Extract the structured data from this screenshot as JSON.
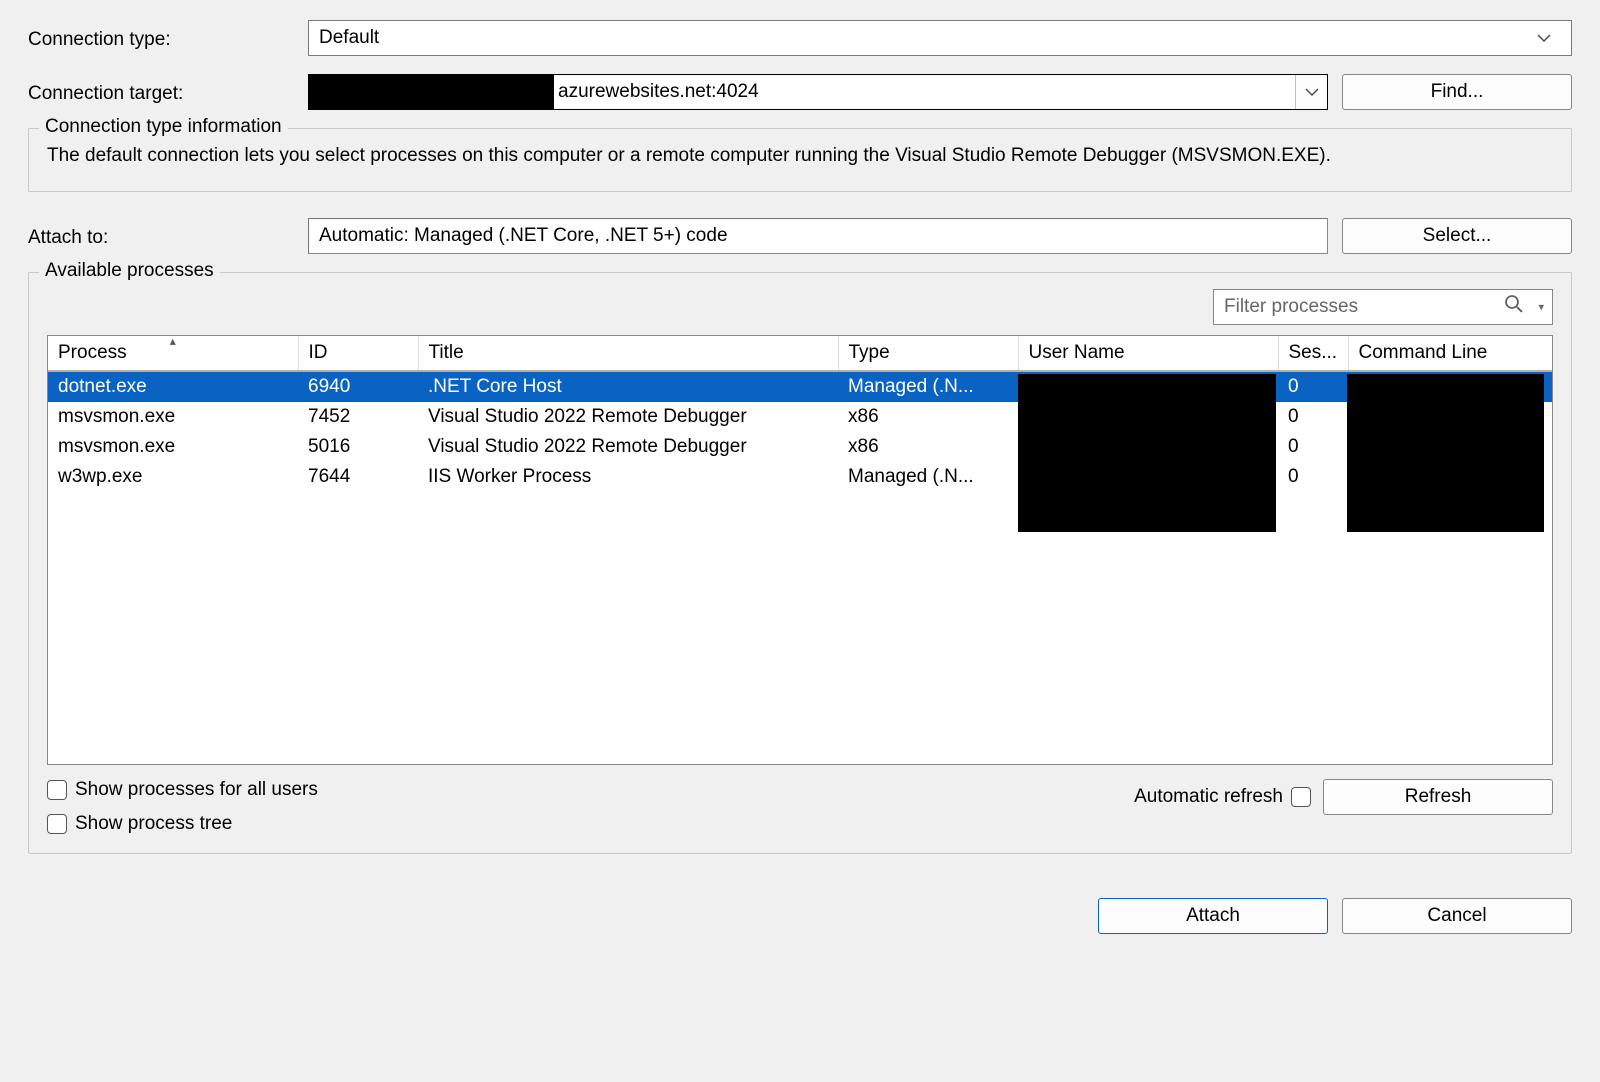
{
  "labels": {
    "connection_type": "Connection type:",
    "connection_target": "Connection target:",
    "attach_to": "Attach to:",
    "find_btn": "Find...",
    "select_btn": "Select...",
    "refresh_btn": "Refresh",
    "attach_btn": "Attach",
    "cancel_btn": "Cancel",
    "automatic_refresh": "Automatic refresh",
    "show_all_users": "Show processes for all users",
    "show_tree": "Show process tree"
  },
  "connection_type_value": "Default",
  "connection_target_value": "azurewebsites.net:4024",
  "groupbox": {
    "legend": "Connection type information",
    "text": "The default connection lets you select processes on this computer or a remote computer running the Visual Studio Remote Debugger (MSVSMON.EXE)."
  },
  "attach_to_value": "Automatic: Managed (.NET Core, .NET 5+) code",
  "available": {
    "legend": "Available processes",
    "filter_placeholder": "Filter processes",
    "columns": {
      "process": "Process",
      "id": "ID",
      "title": "Title",
      "type": "Type",
      "user": "User Name",
      "session": "Ses...",
      "cmd": "Command Line"
    },
    "rows": [
      {
        "process": "dotnet.exe",
        "id": "6940",
        "title": ".NET Core Host",
        "type": "Managed (.N...",
        "session": "0",
        "selected": true
      },
      {
        "process": "msvsmon.exe",
        "id": "7452",
        "title": "Visual Studio 2022 Remote Debugger",
        "type": "x86",
        "session": "0",
        "selected": false
      },
      {
        "process": "msvsmon.exe",
        "id": "5016",
        "title": "Visual Studio 2022 Remote Debugger",
        "type": "x86",
        "session": "0",
        "selected": false
      },
      {
        "process": "w3wp.exe",
        "id": "7644",
        "title": "IIS Worker Process",
        "type": "Managed (.N...",
        "session": "0",
        "selected": false
      }
    ]
  }
}
